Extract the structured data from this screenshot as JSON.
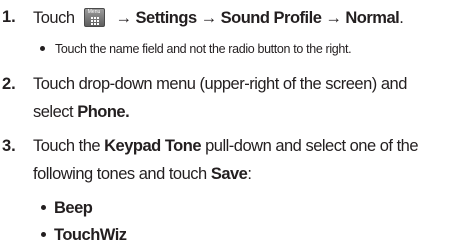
{
  "step1": {
    "number": "1.",
    "touch": "Touch",
    "menu_key_label": "Menu",
    "arrow": "→",
    "settings": "Settings",
    "sound_profile": "Sound Profile",
    "normal": "Normal",
    "period": "."
  },
  "step1_note": "Touch the name field and not the radio button to the right.",
  "step2": {
    "number": "2.",
    "line1": "Touch drop-down menu (upper-right of the screen) and",
    "line2_prefix": "select ",
    "phone": "Phone."
  },
  "step3": {
    "number": "3.",
    "line1_a": "Touch the ",
    "keypad_tone": "Keypad Tone",
    "line1_b": " pull-down and select one of the",
    "line2_a": "following tones and touch ",
    "save": "Save",
    "line2_b": ":"
  },
  "tones": [
    "Beep",
    "TouchWiz"
  ]
}
